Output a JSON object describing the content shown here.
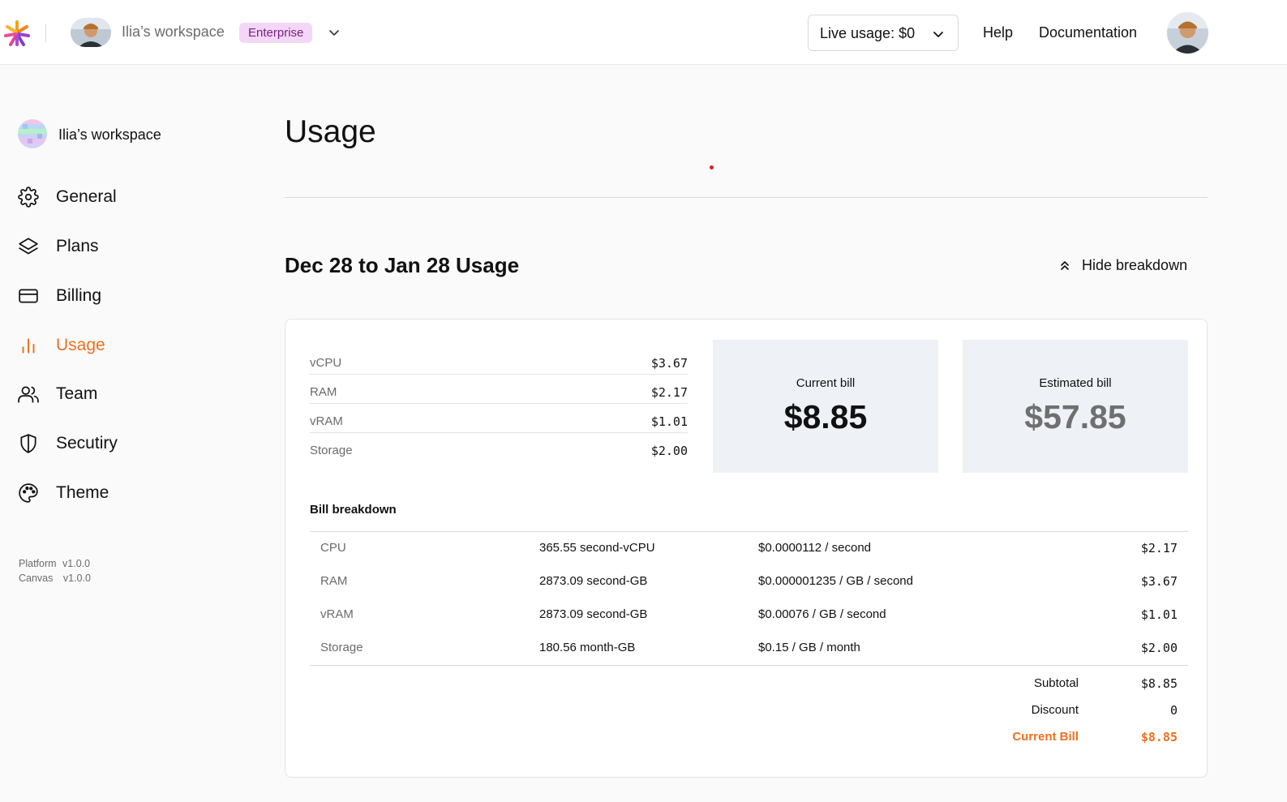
{
  "header": {
    "workspace_name": "Ilia’s workspace",
    "plan_badge": "Enterprise",
    "live_usage": "Live usage: $0",
    "help": "Help",
    "documentation": "Documentation"
  },
  "sidebar": {
    "workspace_name": "Ilia’s workspace",
    "items": [
      {
        "label": "General",
        "icon": "gear-icon"
      },
      {
        "label": "Plans",
        "icon": "layers-icon"
      },
      {
        "label": "Billing",
        "icon": "credit-card-icon"
      },
      {
        "label": "Usage",
        "icon": "bar-chart-icon",
        "active": true
      },
      {
        "label": "Team",
        "icon": "users-icon"
      },
      {
        "label": "Secutiry",
        "icon": "shield-icon"
      },
      {
        "label": "Theme",
        "icon": "palette-icon"
      }
    ],
    "versions": [
      {
        "name": "Platform",
        "version": "v1.0.0"
      },
      {
        "name": "Canvas",
        "version": "v1.0.0"
      }
    ]
  },
  "main": {
    "title": "Usage",
    "period_title": "Dec 28 to Jan 28 Usage",
    "hide_breakdown": "Hide breakdown",
    "summary": [
      {
        "name": "vCPU",
        "value": "$3.67"
      },
      {
        "name": "RAM",
        "value": "$2.17"
      },
      {
        "name": "vRAM",
        "value": "$1.01"
      },
      {
        "name": "Storage",
        "value": "$2.00"
      }
    ],
    "current_bill": {
      "label": "Current bill",
      "amount": "$8.85"
    },
    "estimated_bill": {
      "label": "Estimated bill",
      "amount": "$57.85"
    },
    "breakdown_title": "Bill breakdown",
    "breakdown": [
      {
        "resource": "CPU",
        "quantity": "365.55 second-vCPU",
        "rate": "$0.0000112 / second",
        "cost": "$2.17"
      },
      {
        "resource": "RAM",
        "quantity": "2873.09 second-GB",
        "rate": "$0.000001235 / GB / second",
        "cost": "$3.67"
      },
      {
        "resource": "vRAM",
        "quantity": "2873.09 second-GB",
        "rate": "$0.00076 / GB / second",
        "cost": "$1.01"
      },
      {
        "resource": "Storage",
        "quantity": "180.56 month-GB",
        "rate": "$0.15 / GB / month",
        "cost": "$2.00"
      }
    ],
    "totals": {
      "subtotal_label": "Subtotal",
      "subtotal": "$8.85",
      "discount_label": "Discount",
      "discount": "0",
      "current_bill_label": "Current Bill",
      "current_bill": "$8.85"
    }
  },
  "colors": {
    "accent": "#f06f1f",
    "badge_bg": "#f3d7f7",
    "badge_text": "#7a1f86",
    "bill_box_bg": "#eef1f6"
  }
}
